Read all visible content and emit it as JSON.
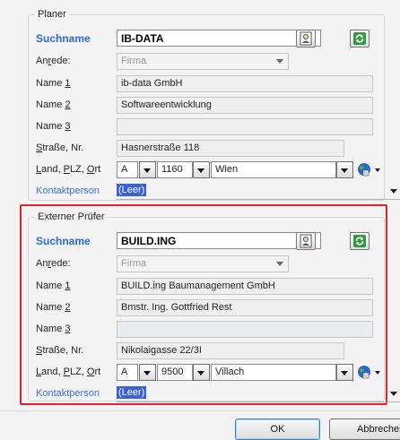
{
  "planer": {
    "legend": "Planer",
    "suchname_label": "Suchname",
    "suchname_value": "IB-DATA",
    "anrede_label": "Anrede:",
    "anrede_value": "Firma",
    "name1_label": "Name 1",
    "name1_value": "ib-data GmbH",
    "name2_label": "Name 2",
    "name2_value": "Softwareentwicklung",
    "name3_label": "Name 3",
    "name3_value": "",
    "strasse_label": "Straße, Nr.",
    "strasse_value": "Hasnerstraße 118",
    "land_label": "Land, PLZ, Ort",
    "land_value": "A",
    "plz_value": "1160",
    "ort_value": "Wien",
    "kontakt_label": "Kontaktperson",
    "kontakt_value": "(Leer)"
  },
  "pruefer": {
    "legend": "Externer Prüfer",
    "suchname_label": "Suchname",
    "suchname_value": "BUILD.ING",
    "anrede_label": "Anrede:",
    "anrede_value": "Firma",
    "name1_label": "Name 1",
    "name1_value": "BUILD.ing Baumanagement GmbH",
    "name2_label": "Name 2",
    "name2_value": "Bmstr. Ing. Gottfried Rest",
    "name3_label": "Name 3",
    "name3_value": "",
    "strasse_label": "Straße, Nr.",
    "strasse_value": "Nikolaigasse 22/3I",
    "land_label": "Land, PLZ, Ort",
    "land_value": "A",
    "plz_value": "9500",
    "ort_value": "Villach",
    "kontakt_label": "Kontaktperson",
    "kontakt_value": "(Leer)"
  },
  "buttons": {
    "ok": "OK",
    "cancel": "Abbrechen"
  },
  "colors": {
    "label_blue": "#2b6bd6",
    "highlight_frame": "#e2232c",
    "selection": "#3a62d8"
  },
  "icons": [
    "person-card-icon",
    "refresh-icon",
    "globe-icon",
    "chevron-down-icon"
  ]
}
